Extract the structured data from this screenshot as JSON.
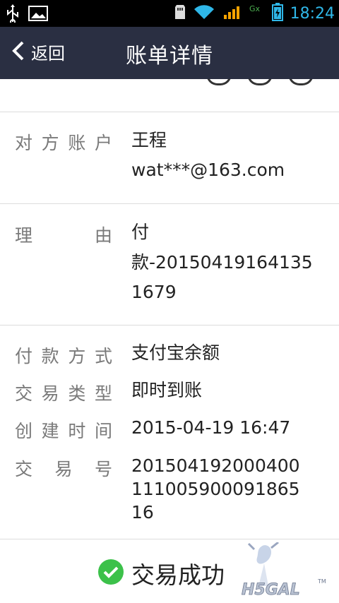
{
  "status_bar": {
    "time": "18:24",
    "icons": [
      "usb-icon",
      "image-icon",
      "sd-card-icon",
      "wifi-icon",
      "signal-3g-icon",
      "signal-gx-icon",
      "battery-icon"
    ]
  },
  "header": {
    "back_label": "返回",
    "title": "账单详情"
  },
  "details": {
    "account": {
      "label_chars": [
        "对",
        "方",
        "账",
        "户"
      ],
      "name": "王程",
      "email": "wat***@163.com"
    },
    "reason": {
      "label_chars": [
        "理",
        "由"
      ],
      "line1": "付",
      "line2": "款-20150419164135",
      "line3": "1679"
    },
    "payment_method": {
      "label_chars": [
        "付",
        "款",
        "方",
        "式"
      ],
      "value": "支付宝余额"
    },
    "trade_type": {
      "label_chars": [
        "交",
        "易",
        "类",
        "型"
      ],
      "value": "即时到账"
    },
    "created_time": {
      "label_chars": [
        "创",
        "建",
        "时",
        "间"
      ],
      "value": "2015-04-19 16:47"
    },
    "trade_no": {
      "label_chars": [
        "交",
        "易",
        "号"
      ],
      "line1": "201504192000400",
      "line2": "111005900091865",
      "line3": "16"
    }
  },
  "footer": {
    "status_text": "交易成功",
    "status_color": "#3cc14a",
    "watermark_text": "H5GAL",
    "watermark_tm": "TM"
  },
  "colors": {
    "status_bar_bg": "#000000",
    "status_bar_accent": "#2fb7e8",
    "title_bar_bg": "#2a2f42",
    "label_color": "#7a7a7a",
    "divider": "#dcdcdc"
  }
}
